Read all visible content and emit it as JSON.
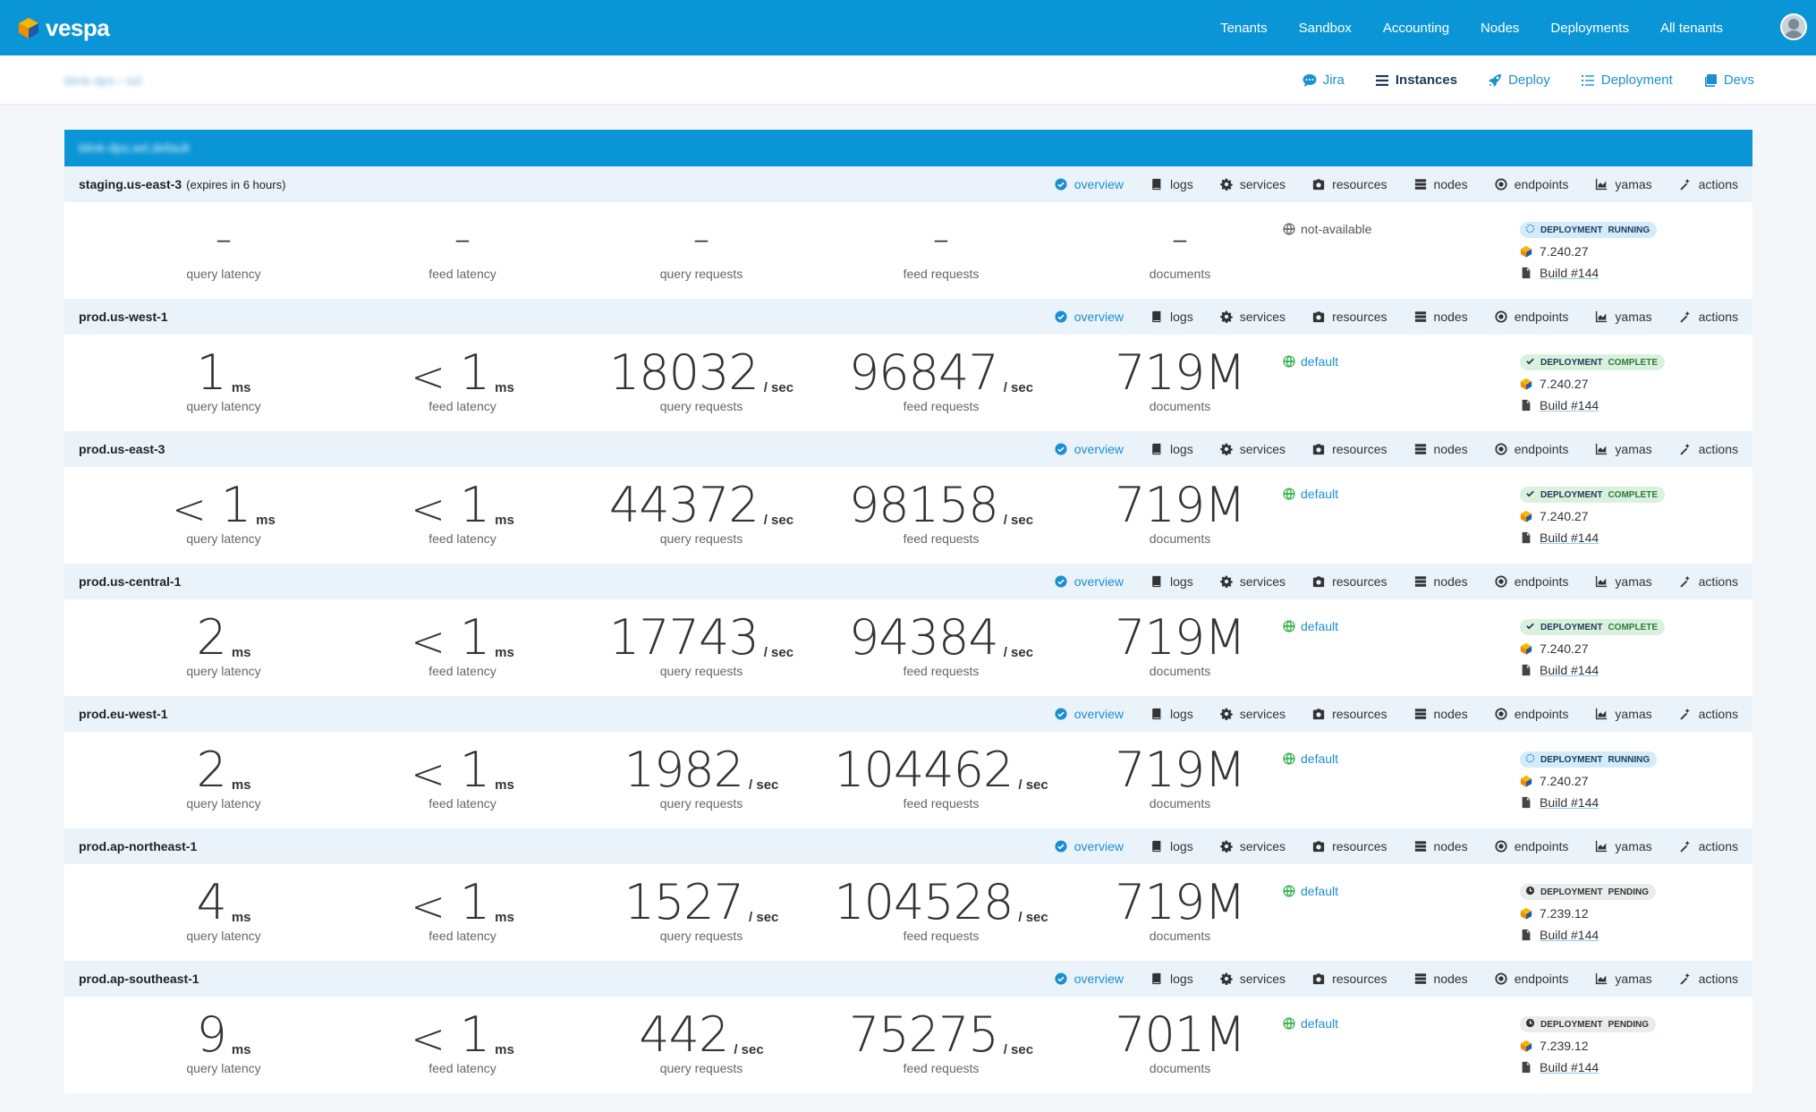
{
  "topnav": {
    "brand": "vespa",
    "items": [
      "Tenants",
      "Sandbox",
      "Accounting",
      "Nodes",
      "Deployments",
      "All tenants"
    ]
  },
  "subbar": {
    "breadcrumb": "blink-dps › sel",
    "items": [
      {
        "label": "Jira",
        "icon": "chat-icon"
      },
      {
        "label": "Instances",
        "icon": "list-icon"
      },
      {
        "label": "Deploy",
        "icon": "rocket-icon"
      },
      {
        "label": "Deployment",
        "icon": "checklist-icon"
      },
      {
        "label": "Devs",
        "icon": "copy-icon"
      }
    ]
  },
  "panel": {
    "title": "blink-dps.sel.default"
  },
  "instance_links": [
    "overview",
    "logs",
    "services",
    "resources",
    "nodes",
    "endpoints",
    "yamas",
    "actions"
  ],
  "metric_labels": [
    "query latency",
    "feed latency",
    "query requests",
    "feed requests",
    "documents"
  ],
  "instances": [
    {
      "name": "staging.us-east-3",
      "note": "(expires in 6 hours)",
      "query_latency": {
        "prefix": "",
        "value": "–",
        "unit": ""
      },
      "feed_latency": {
        "prefix": "",
        "value": "–",
        "unit": ""
      },
      "query_requests": {
        "value": "–",
        "unit": ""
      },
      "feed_requests": {
        "value": "–",
        "unit": ""
      },
      "documents": {
        "value": "–"
      },
      "endpoint": "not-available",
      "deployment": {
        "word": "DEPLOYMENT",
        "status": "RUNNING",
        "version": "7.240.27",
        "build": "Build #144"
      }
    },
    {
      "name": "prod.us-west-1",
      "note": "",
      "query_latency": {
        "prefix": "",
        "value": "1",
        "unit": "ms"
      },
      "feed_latency": {
        "prefix": "<",
        "value": "1",
        "unit": "ms"
      },
      "query_requests": {
        "value": "18032",
        "unit": "/ sec"
      },
      "feed_requests": {
        "value": "96847",
        "unit": "/ sec"
      },
      "documents": {
        "value": "719M"
      },
      "endpoint": "default",
      "deployment": {
        "word": "DEPLOYMENT",
        "status": "COMPLETE",
        "version": "7.240.27",
        "build": "Build #144"
      }
    },
    {
      "name": "prod.us-east-3",
      "note": "",
      "query_latency": {
        "prefix": "<",
        "value": "1",
        "unit": "ms"
      },
      "feed_latency": {
        "prefix": "<",
        "value": "1",
        "unit": "ms"
      },
      "query_requests": {
        "value": "44372",
        "unit": "/ sec"
      },
      "feed_requests": {
        "value": "98158",
        "unit": "/ sec"
      },
      "documents": {
        "value": "719M"
      },
      "endpoint": "default",
      "deployment": {
        "word": "DEPLOYMENT",
        "status": "COMPLETE",
        "version": "7.240.27",
        "build": "Build #144"
      }
    },
    {
      "name": "prod.us-central-1",
      "note": "",
      "query_latency": {
        "prefix": "",
        "value": "2",
        "unit": "ms"
      },
      "feed_latency": {
        "prefix": "<",
        "value": "1",
        "unit": "ms"
      },
      "query_requests": {
        "value": "17743",
        "unit": "/ sec"
      },
      "feed_requests": {
        "value": "94384",
        "unit": "/ sec"
      },
      "documents": {
        "value": "719M"
      },
      "endpoint": "default",
      "deployment": {
        "word": "DEPLOYMENT",
        "status": "COMPLETE",
        "version": "7.240.27",
        "build": "Build #144"
      }
    },
    {
      "name": "prod.eu-west-1",
      "note": "",
      "query_latency": {
        "prefix": "",
        "value": "2",
        "unit": "ms"
      },
      "feed_latency": {
        "prefix": "<",
        "value": "1",
        "unit": "ms"
      },
      "query_requests": {
        "value": "1982",
        "unit": "/ sec"
      },
      "feed_requests": {
        "value": "104462",
        "unit": "/ sec"
      },
      "documents": {
        "value": "719M"
      },
      "endpoint": "default",
      "deployment": {
        "word": "DEPLOYMENT",
        "status": "RUNNING",
        "version": "7.240.27",
        "build": "Build #144"
      }
    },
    {
      "name": "prod.ap-northeast-1",
      "note": "",
      "query_latency": {
        "prefix": "",
        "value": "4",
        "unit": "ms"
      },
      "feed_latency": {
        "prefix": "<",
        "value": "1",
        "unit": "ms"
      },
      "query_requests": {
        "value": "1527",
        "unit": "/ sec"
      },
      "feed_requests": {
        "value": "104528",
        "unit": "/ sec"
      },
      "documents": {
        "value": "719M"
      },
      "endpoint": "default",
      "deployment": {
        "word": "DEPLOYMENT",
        "status": "PENDING",
        "version": "7.239.12",
        "build": "Build #144"
      }
    },
    {
      "name": "prod.ap-southeast-1",
      "note": "",
      "query_latency": {
        "prefix": "",
        "value": "9",
        "unit": "ms"
      },
      "feed_latency": {
        "prefix": "<",
        "value": "1",
        "unit": "ms"
      },
      "query_requests": {
        "value": "442",
        "unit": "/ sec"
      },
      "feed_requests": {
        "value": "75275",
        "unit": "/ sec"
      },
      "documents": {
        "value": "701M"
      },
      "endpoint": "default",
      "deployment": {
        "word": "DEPLOYMENT",
        "status": "PENDING",
        "version": "7.239.12",
        "build": "Build #144"
      }
    }
  ],
  "colors": {
    "brand_blue": "#0a96d6",
    "link_blue": "#1c8fd2",
    "row_header": "#eaf3fa",
    "status_running": "#d3ebfa",
    "status_complete": "#daf1de",
    "status_pending": "#e9ecee",
    "globe_green": "#2eb04a"
  }
}
